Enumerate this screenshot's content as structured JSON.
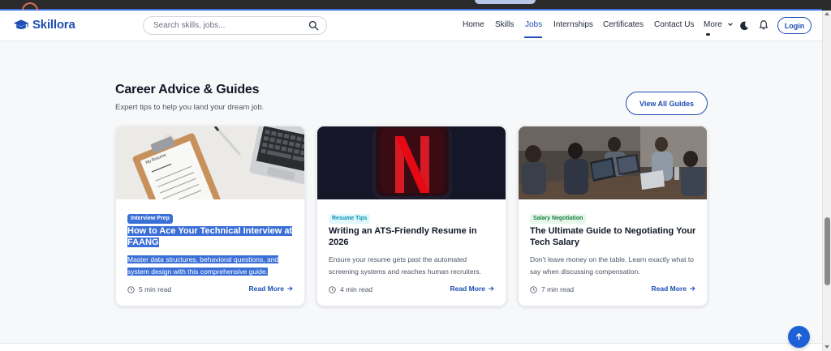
{
  "brand": {
    "name": "Skillora"
  },
  "search": {
    "placeholder": "Search skills, jobs..."
  },
  "nav": {
    "items": [
      {
        "label": "Home"
      },
      {
        "label": "Skills"
      },
      {
        "label": "Jobs",
        "active": true
      },
      {
        "label": "Internships"
      },
      {
        "label": "Certificates"
      },
      {
        "label": "Contact Us"
      },
      {
        "label": "More"
      }
    ],
    "login_label": "Login"
  },
  "section": {
    "title": "Career Advice & Guides",
    "subtitle": "Expert tips to help you land your dream job.",
    "view_all_label": "View All Guides"
  },
  "cards": [
    {
      "badge": "Interview Prep",
      "badge_color": "#1e4fb3",
      "title": "How to Ace Your Technical Interview at FAANG",
      "description": "Master data structures, behavioral questions, and system design with this comprehensive guide.",
      "read_time": "5 min read",
      "link_label": "Read More",
      "image_note": "My Resume",
      "selected": true
    },
    {
      "badge": "Resume Tips",
      "badge_color": "#0891b2",
      "title": "Writing an ATS-Friendly Resume in 2026",
      "description": "Ensure your resume gets past the automated screening systems and reaches human recruiters.",
      "read_time": "4 min read",
      "link_label": "Read More"
    },
    {
      "badge": "Salary Negotiation",
      "badge_color": "#15803d",
      "title": "The Ultimate Guide to Negotiating Your Tech Salary",
      "description": "Don't leave money on the table. Learn exactly what to say when discussing compensation.",
      "read_time": "7 min read",
      "link_label": "Read More"
    }
  ],
  "colors": {
    "accent": "#1e4fb3",
    "selection": "#3a6fd8",
    "background": "#f7f8fa"
  }
}
